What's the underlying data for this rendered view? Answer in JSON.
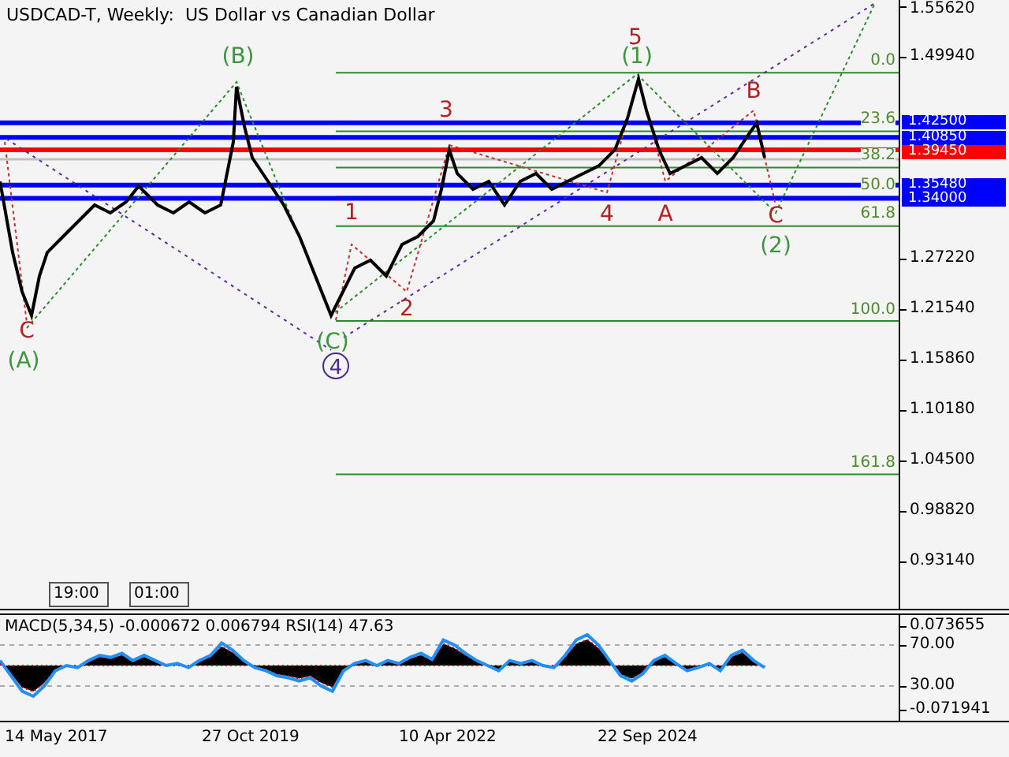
{
  "chart": {
    "title": "USDCAD-T, Weekly:  US Dollar vs Canadian Dollar",
    "price_scale": [
      "1.55620",
      "1.49940",
      "1.27220",
      "1.21540",
      "1.15860",
      "1.10180",
      "1.04500",
      "0.98820",
      "0.93140"
    ],
    "price_levels": [
      {
        "price": "1.42500",
        "color": "#0000ff"
      },
      {
        "price": "1.40850",
        "color": "#0000ff"
      },
      {
        "price": "1.39450",
        "color": "#ff0000"
      },
      {
        "price": "1.35480",
        "color": "#0000ff"
      },
      {
        "price": "1.34000",
        "color": "#0000ff"
      }
    ],
    "fibonacci_levels": [
      "0.0",
      "23.6",
      "38.2",
      "50.0",
      "61.8",
      "100.0",
      "161.8"
    ],
    "wave_labels": [
      {
        "text": "C",
        "color": "#b22222",
        "kind": "plain"
      },
      {
        "text": "(A)",
        "color": "#3c963c",
        "kind": "plain"
      },
      {
        "text": "(B)",
        "color": "#3c963c",
        "kind": "plain"
      },
      {
        "text": "(C)",
        "color": "#3c963c",
        "kind": "plain"
      },
      {
        "text": "4",
        "color": "#4b2a8a",
        "kind": "circled"
      },
      {
        "text": "1",
        "color": "#b22222",
        "kind": "plain"
      },
      {
        "text": "2",
        "color": "#b22222",
        "kind": "plain"
      },
      {
        "text": "3",
        "color": "#b22222",
        "kind": "plain"
      },
      {
        "text": "4",
        "color": "#b22222",
        "kind": "plain"
      },
      {
        "text": "(1)",
        "color": "#3c963c",
        "kind": "plain"
      },
      {
        "text": "5",
        "color": "#b22222",
        "kind": "plain"
      },
      {
        "text": "A",
        "color": "#b22222",
        "kind": "plain"
      },
      {
        "text": "B",
        "color": "#b22222",
        "kind": "plain"
      },
      {
        "text": "C",
        "color": "#b22222",
        "kind": "plain"
      },
      {
        "text": "(2)",
        "color": "#3c963c",
        "kind": "plain"
      }
    ],
    "time_markers": [
      "19:00",
      "01:00"
    ]
  },
  "indicator": {
    "title": "MACD(5,34,5) -0.000672 0.006794 RSI(14) 47.63",
    "scale": [
      "0.073655",
      "70.00",
      "30.00",
      "-0.071941"
    ]
  },
  "time_scale": [
    "14 May 2017",
    "27 Oct 2019",
    "10 Apr 2022",
    "22 Sep 2024"
  ]
}
